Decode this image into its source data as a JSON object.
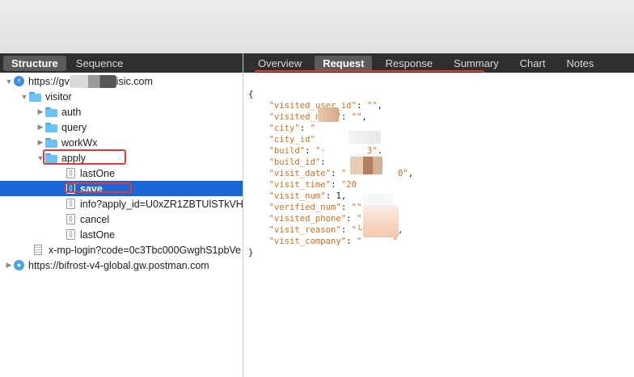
{
  "tabs": {
    "left": [
      {
        "label": "Structure",
        "active": true
      },
      {
        "label": "Sequence",
        "active": false
      }
    ],
    "right": [
      {
        "label": "Overview",
        "active": false
      },
      {
        "label": "Request",
        "active": true
      },
      {
        "label": "Response",
        "active": false
      },
      {
        "label": "Summary",
        "active": false
      },
      {
        "label": "Chart",
        "active": false
      },
      {
        "label": "Notes",
        "active": false
      }
    ]
  },
  "tree": {
    "host1_prefix": "https://gv",
    "host1_suffix": "isic.com",
    "visitor": "visitor",
    "auth": "auth",
    "query": "query",
    "workWx": "workWx",
    "apply": "apply",
    "lastOne1": "lastOne",
    "save": "save",
    "info": "info?apply_id=U0xZR1ZBTUlSTkVH",
    "cancel": "cancel",
    "lastOne2": "lastOne",
    "login": "x-mp-login?code=0c3Tbc000GwghS1pbVe",
    "host2": "https://bifrost-v4-global.gw.postman.com"
  },
  "request_body": {
    "open": "{",
    "close": "}",
    "lines": [
      {
        "key": "\"visited_user_id\"",
        "value": "\"\"",
        "type": "str"
      },
      {
        "key": "\"visited_name\"",
        "value": "\"\"",
        "type": "str"
      },
      {
        "key": "\"city\"",
        "value": "\"",
        "type": "str"
      },
      {
        "key": "\"city_id\"",
        "value": "",
        "type": "str"
      },
      {
        "key": "\"build\"",
        "value": "\"·",
        "type": "str",
        "tail": "3\""
      },
      {
        "key": "\"build_id\"",
        "value": "",
        "type": "str"
      },
      {
        "key": "\"visit_date\"",
        "value": "\"",
        "type": "str",
        "tail": "0\""
      },
      {
        "key": "\"visit_time\"",
        "value": "\"20",
        "type": "str"
      },
      {
        "key": "\"visit_num\"",
        "value": "1",
        "type": "num"
      },
      {
        "key": "\"verified_num\"",
        "value": "\"\"",
        "type": "str"
      },
      {
        "key": "\"visited_phone\"",
        "value": "\"",
        "type": "str"
      },
      {
        "key": "\"visit_reason\"",
        "value": "\"└",
        "type": "str",
        "tail": "\""
      },
      {
        "key": "\"visit_company\"",
        "value": "\"",
        "type": "str",
        "tail": "\""
      }
    ]
  },
  "icons": {
    "host1": "bolt-icon",
    "host2": "globe-icon",
    "folder": "folder-icon",
    "file": "file-brace-icon",
    "doc": "document-icon"
  },
  "colors": {
    "selection": "#1a66d6",
    "highlight": "#e53935",
    "json_key": "#c9711e"
  }
}
